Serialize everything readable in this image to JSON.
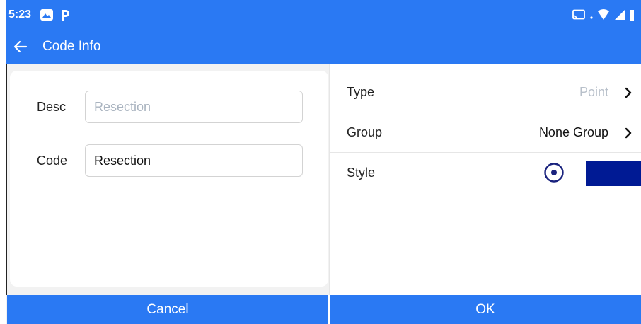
{
  "status_bar": {
    "time": "5:23",
    "icons": [
      "gallery-icon",
      "parking-p-icon",
      "cast-icon",
      "wifi-icon",
      "signal-icon",
      "battery-icon"
    ],
    "color": "#2a79f3"
  },
  "title_bar": {
    "title": "Code Info",
    "back_icon": "arrow-left-icon"
  },
  "form": {
    "desc_label": "Desc",
    "desc_placeholder": "Resection",
    "desc_value": "",
    "code_label": "Code",
    "code_value": "Resection"
  },
  "properties": {
    "type_label": "Type",
    "type_value": "Point",
    "type_value_color": "#b8c0ca",
    "group_label": "Group",
    "group_value": "None Group",
    "style_label": "Style",
    "style_radio_icon": "radio-dot-icon",
    "style_color": "#001a94"
  },
  "footer": {
    "cancel_label": "Cancel",
    "ok_label": "OK"
  },
  "colors": {
    "accent": "#2a79f3",
    "radio": "#1a237e"
  }
}
